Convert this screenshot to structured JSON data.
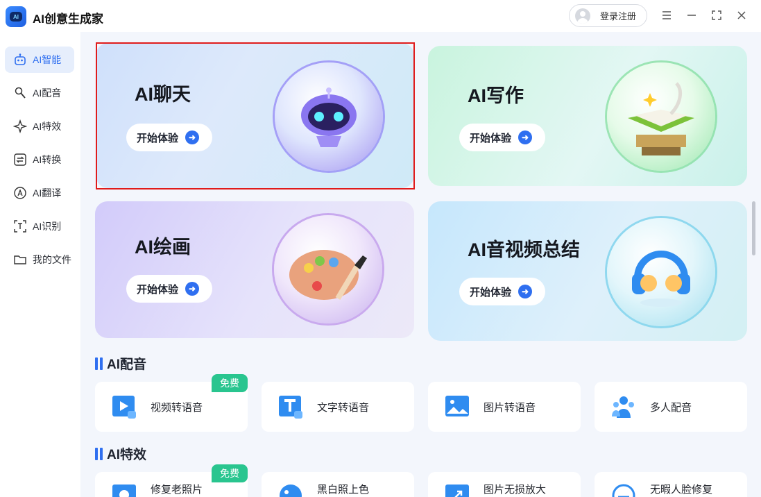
{
  "app": {
    "title": "AI创意生成家",
    "logo_text": "AI"
  },
  "header": {
    "login_label": "登录注册"
  },
  "window_controls": [
    "menu-icon",
    "minimize-icon",
    "maximize-icon",
    "close-icon"
  ],
  "sidebar": {
    "items": [
      {
        "label": "AI智能",
        "icon": "robot-icon",
        "active": true
      },
      {
        "label": "AI配音",
        "icon": "microphone-icon",
        "active": false
      },
      {
        "label": "AI特效",
        "icon": "sparkle-icon",
        "active": false
      },
      {
        "label": "AI转换",
        "icon": "convert-icon",
        "active": false
      },
      {
        "label": "AI翻译",
        "icon": "translate-icon",
        "active": false
      },
      {
        "label": "AI识别",
        "icon": "scan-text-icon",
        "active": false
      },
      {
        "label": "我的文件",
        "icon": "folder-icon",
        "active": false
      }
    ]
  },
  "feature_cards": [
    {
      "title": "AI聊天",
      "button": "开始体验",
      "illustration": "robot-sphere-icon"
    },
    {
      "title": "AI写作",
      "button": "开始体验",
      "illustration": "book-sphere-icon"
    },
    {
      "title": "AI绘画",
      "button": "开始体验",
      "illustration": "palette-sphere-icon"
    },
    {
      "title": "AI音视频总结",
      "button": "开始体验",
      "illustration": "headphones-sphere-icon"
    }
  ],
  "sections": [
    {
      "title": "AI配音",
      "tools": [
        {
          "label": "视频转语音",
          "icon": "video-to-audio-icon",
          "badge": "免费"
        },
        {
          "label": "文字转语音",
          "icon": "text-to-audio-icon",
          "badge": ""
        },
        {
          "label": "图片转语音",
          "icon": "image-to-audio-icon",
          "badge": ""
        },
        {
          "label": "多人配音",
          "icon": "multi-voice-icon",
          "badge": ""
        }
      ]
    },
    {
      "title": "AI特效",
      "tools": [
        {
          "label": "修复老照片",
          "icon": "photo-restore-icon",
          "badge": "免费"
        },
        {
          "label": "黑白照上色",
          "icon": "colorize-icon",
          "badge": ""
        },
        {
          "label": "图片无损放大",
          "icon": "upscale-icon",
          "badge": ""
        },
        {
          "label": "无暇人脸修复",
          "icon": "face-restore-icon",
          "badge": ""
        }
      ]
    }
  ],
  "colors": {
    "accent": "#2f6ff0",
    "badge": "#29c58f",
    "highlight": "#e01b1b"
  }
}
